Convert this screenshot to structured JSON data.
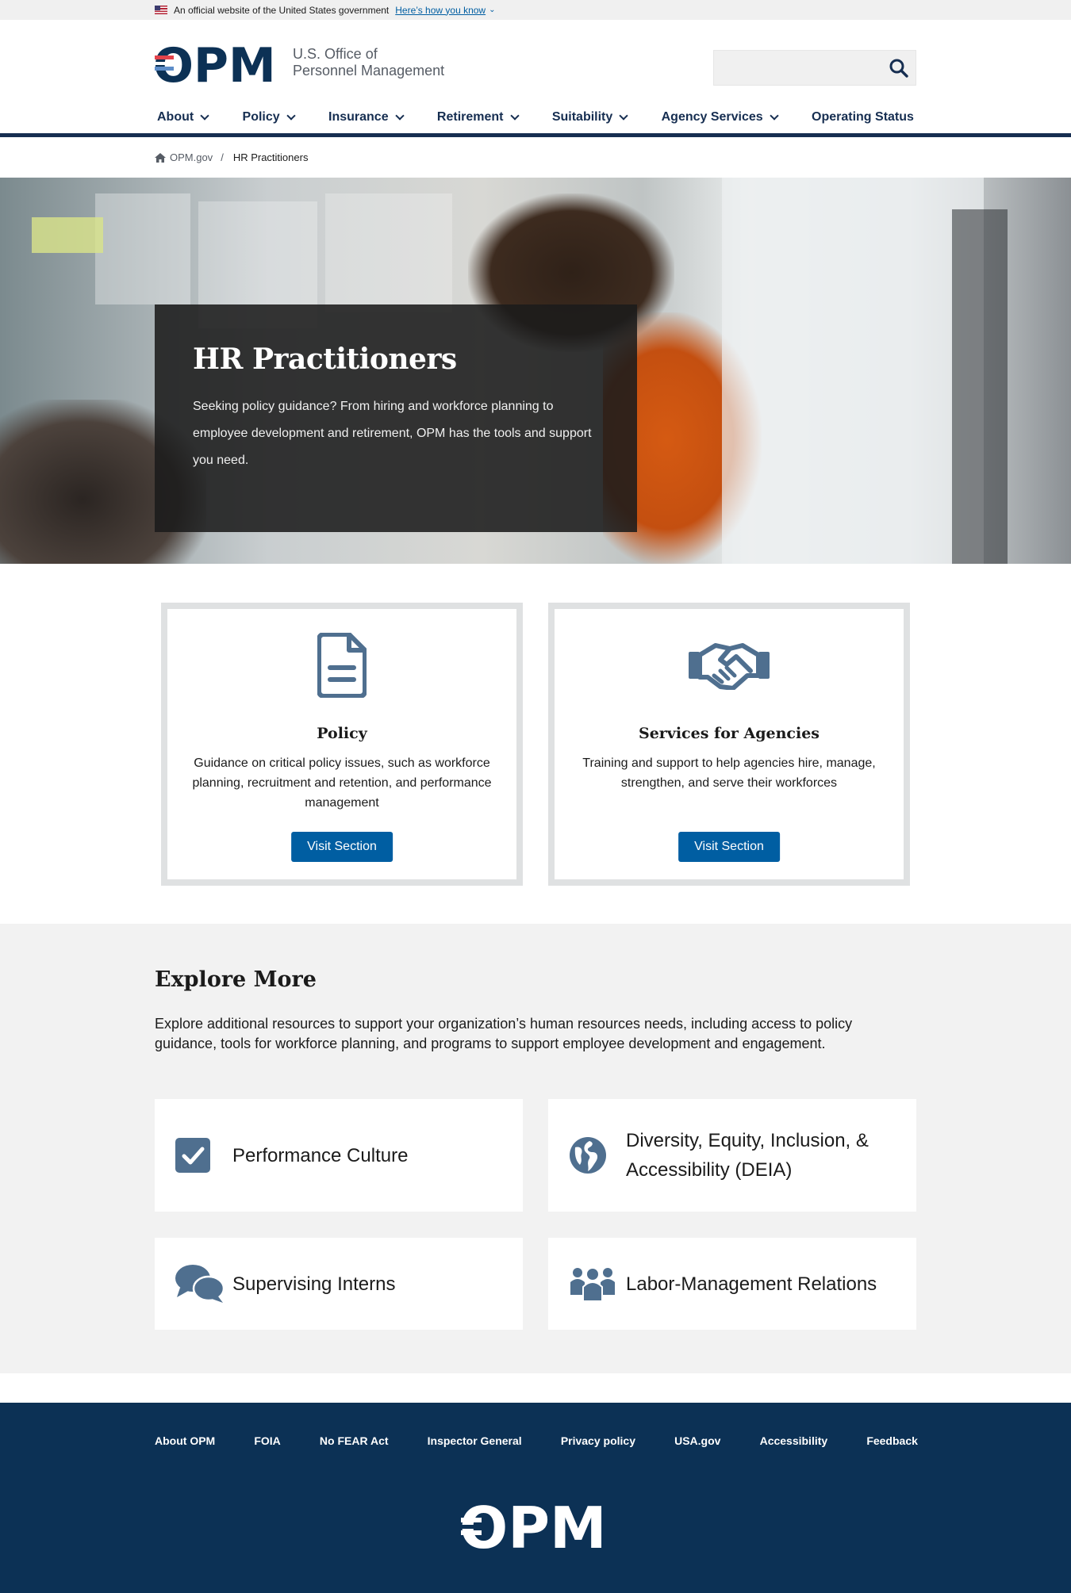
{
  "banner": {
    "text": "An official website of the United States government",
    "link": "Here’s how you know"
  },
  "header": {
    "logo_mark": "OPM",
    "logo_line1": "U.S. Office of",
    "logo_line2": "Personnel Management",
    "search": {
      "placeholder": "",
      "value": ""
    }
  },
  "nav": [
    {
      "label": "About",
      "dropdown": true
    },
    {
      "label": "Policy",
      "dropdown": true
    },
    {
      "label": "Insurance",
      "dropdown": true
    },
    {
      "label": "Retirement",
      "dropdown": true
    },
    {
      "label": "Suitability",
      "dropdown": true
    },
    {
      "label": "Agency Services",
      "dropdown": true
    },
    {
      "label": "Operating Status",
      "dropdown": false
    }
  ],
  "breadcrumb": {
    "home": "OPM.gov",
    "separator": "/",
    "current": "HR Practitioners"
  },
  "hero": {
    "title": "HR Practitioners",
    "text": "Seeking policy guidance? From hiring and workforce planning to employee development and retirement, OPM has the tools and support you need."
  },
  "cards": [
    {
      "icon": "document-icon",
      "title": "Policy",
      "text": "Guidance on critical policy issues, such as workforce planning, recruitment and retention, and performance management",
      "button": "Visit Section"
    },
    {
      "icon": "handshake-icon",
      "title": "Services for Agencies",
      "text": "Training and support to help agencies hire, manage, strengthen, and serve their workforces",
      "button": "Visit Section"
    }
  ],
  "explore": {
    "title": "Explore More",
    "intro": "Explore additional resources to support your organization’s human resources needs, including access to policy guidance, tools for workforce planning, and programs to support employee development and engagement.",
    "tiles": [
      {
        "icon": "checkbox-icon",
        "label": "Performance Culture"
      },
      {
        "icon": "globe-icon",
        "label": "Diversity, Equity, Inclusion, & Accessibility (DEIA)"
      },
      {
        "icon": "chat-bubbles-icon",
        "label": "Supervising Interns"
      },
      {
        "icon": "people-group-icon",
        "label": "Labor-Management Relations"
      }
    ]
  },
  "footer": {
    "links": [
      "About OPM",
      "FOIA",
      "No FEAR Act",
      "Inspector General",
      "Privacy policy",
      "USA.gov",
      "Accessibility",
      "Feedback"
    ],
    "logo_mark": "OPM"
  },
  "colors": {
    "navy": "#162e51",
    "primary_button": "#005ea2",
    "footer_bg": "#0c3155",
    "icon_slate": "#4f6f8f",
    "logo_red": "#e3434b",
    "logo_blue": "#0c3155"
  }
}
